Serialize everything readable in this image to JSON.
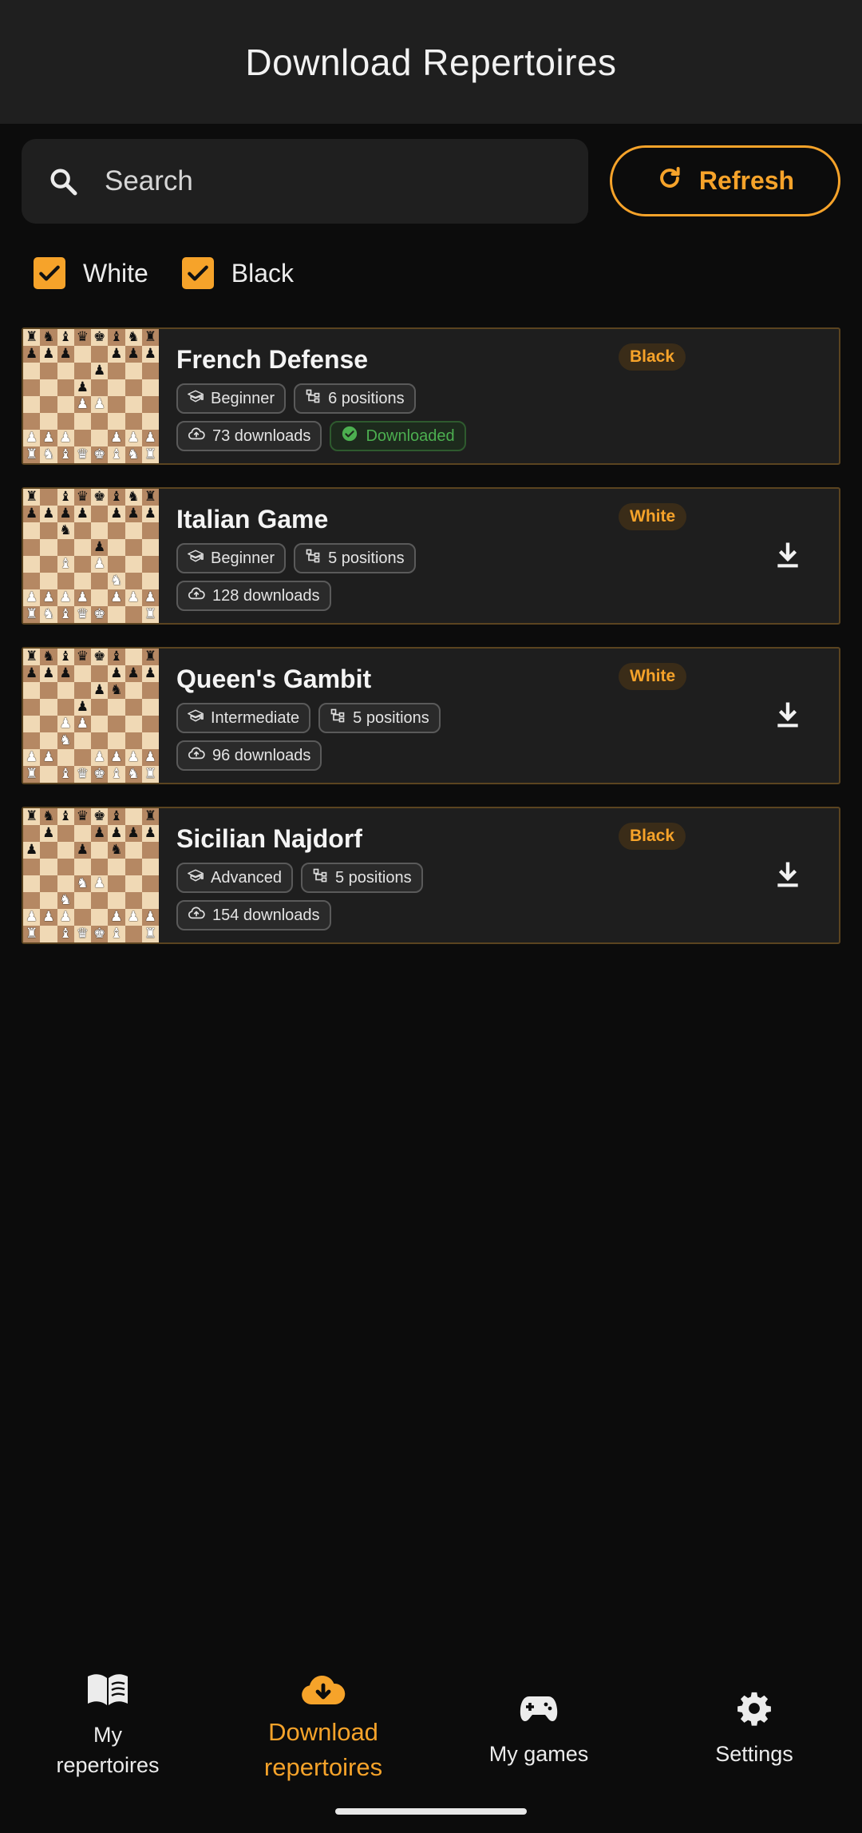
{
  "header": {
    "title": "Download Repertoires"
  },
  "search": {
    "placeholder": "Search",
    "value": ""
  },
  "refresh_label": "Refresh",
  "filters": [
    {
      "label": "White",
      "checked": true
    },
    {
      "label": "Black",
      "checked": true
    }
  ],
  "colors": {
    "accent": "#f6a32a",
    "background": "#0c0c0c",
    "card": "#1e1e1e",
    "downloaded": "#4caf50"
  },
  "repertoires": [
    {
      "name": "French Defense",
      "color": "Black",
      "level": "Beginner",
      "positions": "6 positions",
      "downloads": "73 downloads",
      "status": "Downloaded",
      "downloaded": true,
      "board": [
        "rnbqkbnr",
        "ppp..ppp",
        "....p...",
        "...p....",
        "...PP...",
        "........",
        "PPP..PPP",
        "RNBQKBNR"
      ]
    },
    {
      "name": "Italian Game",
      "color": "White",
      "level": "Beginner",
      "positions": "5 positions",
      "downloads": "128 downloads",
      "downloaded": false,
      "board": [
        "r.bqkbnr",
        "pppp.ppp",
        "..n.....",
        "....p...",
        "..B.P...",
        ".....N..",
        "PPPP.PPP",
        "RNBQK..R"
      ]
    },
    {
      "name": "Queen's Gambit",
      "color": "White",
      "level": "Intermediate",
      "positions": "5 positions",
      "downloads": "96 downloads",
      "downloaded": false,
      "board": [
        "rnbqkb.r",
        "ppp..ppp",
        "....pn..",
        "...p....",
        "..PP....",
        "..N.....",
        "PP..PPPP",
        "R.BQKBNR"
      ]
    },
    {
      "name": "Sicilian Najdorf",
      "color": "Black",
      "level": "Advanced",
      "positions": "5 positions",
      "downloads": "154 downloads",
      "downloaded": false,
      "board": [
        "rnbqkb.r",
        ".p..pppp",
        "p..p.n..",
        "........",
        "...NP...",
        "..N.....",
        "PPP..PPP",
        "R.BQKB.R"
      ]
    }
  ],
  "nav": [
    {
      "label_line1": "My",
      "label_line2": "repertoires",
      "icon": "book-icon",
      "active": false
    },
    {
      "label_line1": "Download",
      "label_line2": "repertoires",
      "icon": "cloud-download-icon",
      "active": true
    },
    {
      "label_line1": "My games",
      "label_line2": "",
      "icon": "gamepad-icon",
      "active": false
    },
    {
      "label_line1": "Settings",
      "label_line2": "",
      "icon": "gear-icon",
      "active": false
    }
  ]
}
